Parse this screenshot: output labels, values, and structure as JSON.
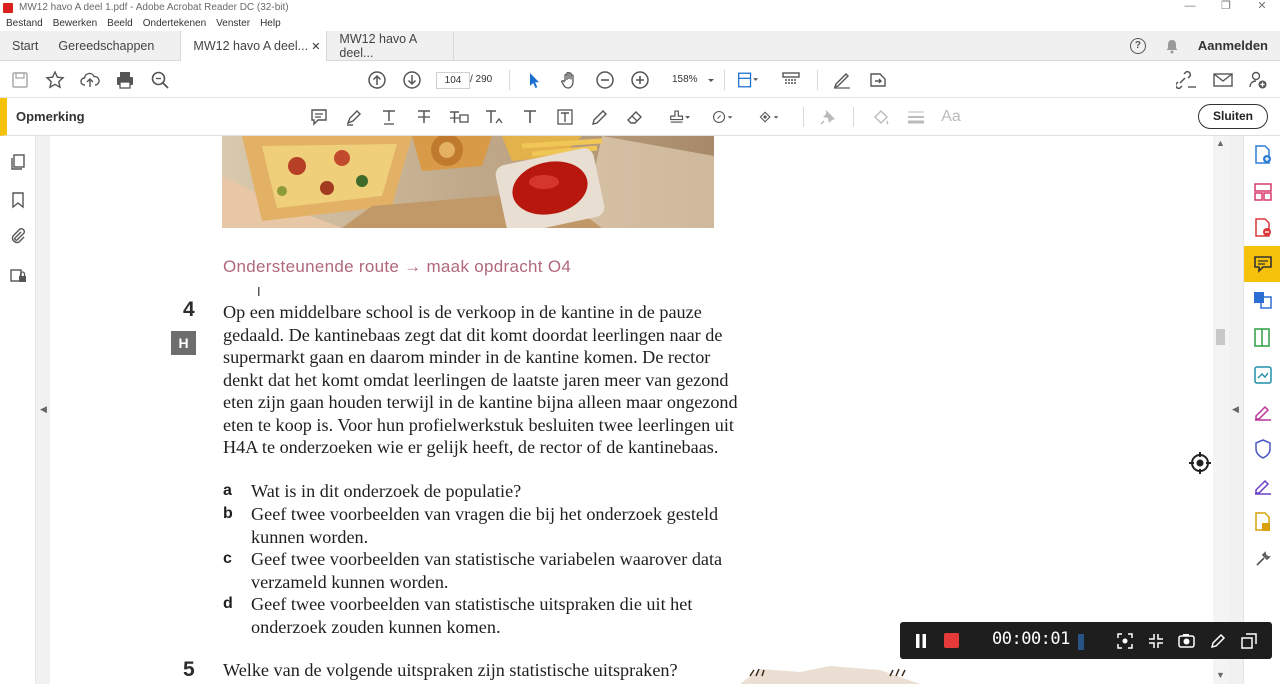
{
  "window": {
    "title": "MW12 havo A deel 1.pdf - Adobe Acrobat Reader DC (32-bit)",
    "minimize": "—",
    "restore": "❐",
    "close": "✕"
  },
  "menu": [
    "Bestand",
    "Bewerken",
    "Beeld",
    "Ondertekenen",
    "Venster",
    "Help"
  ],
  "tabs": {
    "home": "Start",
    "tools": "Gereedschappen",
    "doc_active": "MW12 havo A deel...",
    "doc_other": "MW12 havo A deel...",
    "signin": "Aanmelden",
    "help_glyph": "?"
  },
  "toolbar": {
    "page_current": "104",
    "page_total": "/ 290",
    "zoom": "158%"
  },
  "comment_bar": {
    "label": "Opmerking",
    "close": "Sluiten"
  },
  "document": {
    "route": "Ondersteunende route → maak opdracht O4",
    "q4": {
      "number": "4",
      "badge": "H",
      "text": "Op een middelbare school is de verkoop in de kantine in de pauze gedaald. De kantinebaas zegt dat dit komt doordat leerlingen naar de supermarkt gaan en daarom minder in de kantine komen. De rector denkt dat het komt omdat leerlingen de laatste jaren meer van gezond eten zijn gaan houden terwijl in de kantine bijna alleen maar ongezond eten te koop is. Voor hun profielwerkstuk besluiten twee leerlingen uit H4A te onderzoeken wie er gelijk heeft, de rector of de kantinebaas.",
      "subs": [
        {
          "letter": "a",
          "text": "Wat is in dit onderzoek de populatie?"
        },
        {
          "letter": "b",
          "text": "Geef twee voorbeelden van vragen die bij het onderzoek gesteld kunnen worden."
        },
        {
          "letter": "c",
          "text": "Geef twee voorbeelden van statistische variabelen waarover data verzameld kunnen worden."
        },
        {
          "letter": "d",
          "text": "Geef twee voorbeelden van statistische uitspraken die uit het onderzoek zouden kunnen komen."
        }
      ]
    },
    "q5": {
      "number": "5",
      "text": "Welke van de volgende uitspraken zijn statistische uitspraken?"
    }
  },
  "recorder": {
    "time": "00:00:01"
  }
}
